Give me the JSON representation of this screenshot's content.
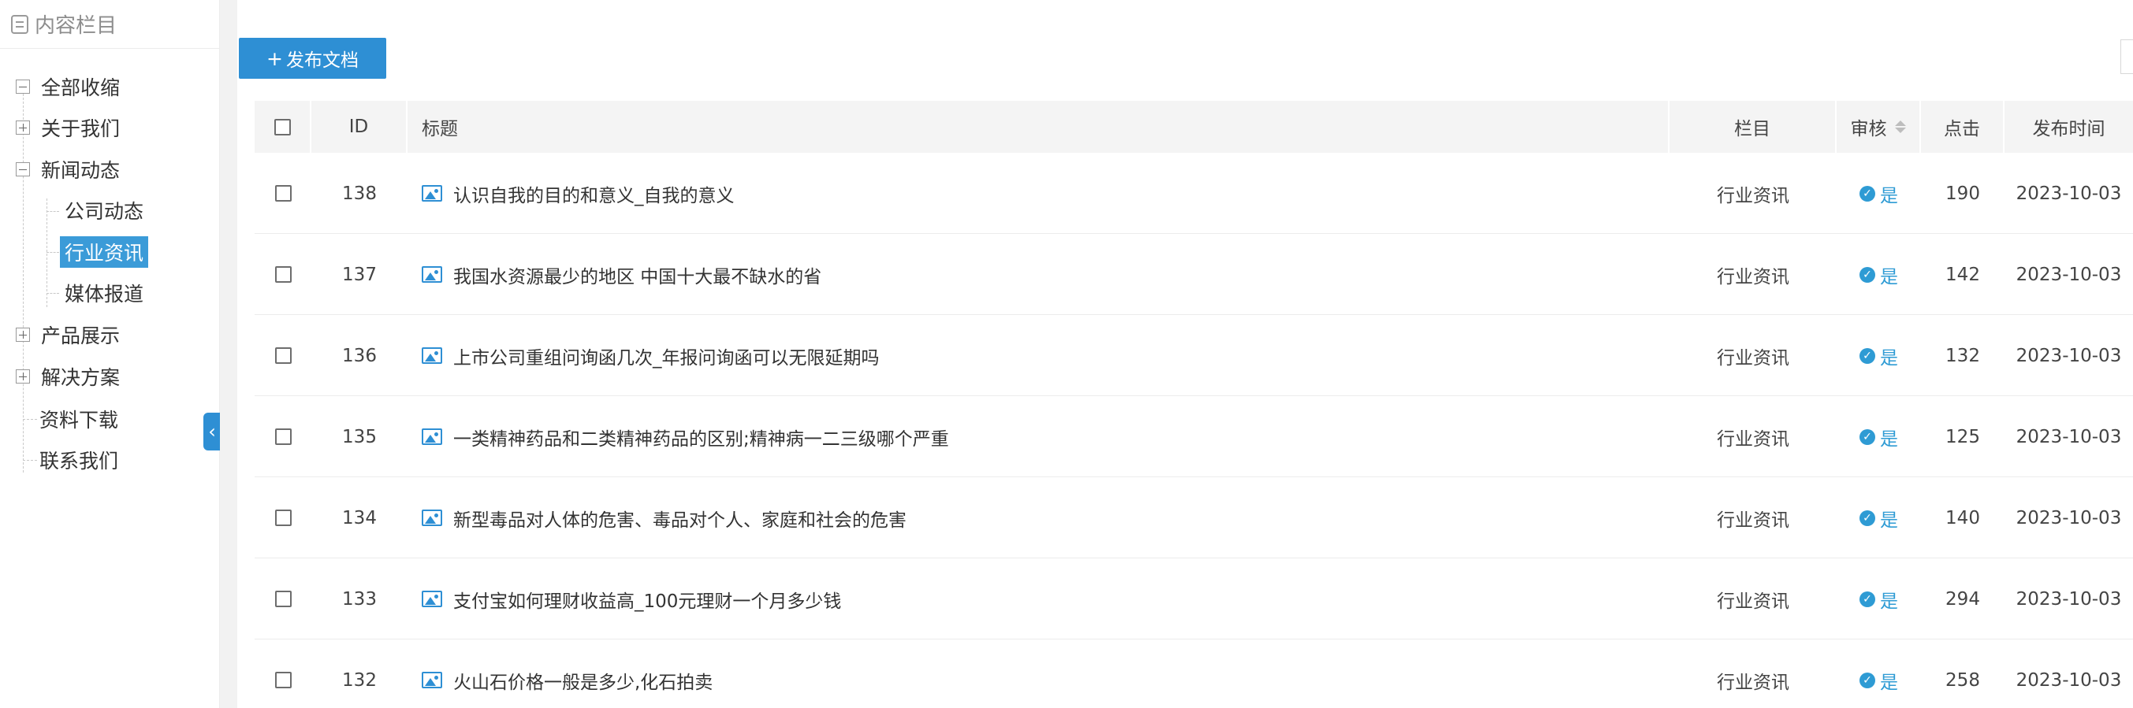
{
  "sidebar": {
    "header": "内容栏目",
    "items": [
      {
        "label": "全部收缩"
      },
      {
        "label": "关于我们"
      },
      {
        "label": "新闻动态"
      },
      {
        "label": "公司动态"
      },
      {
        "label": "行业资讯"
      },
      {
        "label": "媒体报道"
      },
      {
        "label": "产品展示"
      },
      {
        "label": "解决方案"
      },
      {
        "label": "资料下载"
      },
      {
        "label": "联系我们"
      }
    ],
    "selected": "行业资讯"
  },
  "toolbar": {
    "publish_label": "发布文档",
    "publish_plus": "+"
  },
  "table": {
    "headers": {
      "id": "ID",
      "title": "标题",
      "column": "栏目",
      "review": "审核",
      "clicks": "点击",
      "date": "发布时间"
    },
    "rows": [
      {
        "id": "138",
        "title": "认识自我的目的和意义_自我的意义",
        "column": "行业资讯",
        "review": "是",
        "clicks": "190",
        "date": "2023-10-03"
      },
      {
        "id": "137",
        "title": "我国水资源最少的地区 中国十大最不缺水的省",
        "column": "行业资讯",
        "review": "是",
        "clicks": "142",
        "date": "2023-10-03"
      },
      {
        "id": "136",
        "title": "上市公司重组问询函几次_年报问询函可以无限延期吗",
        "column": "行业资讯",
        "review": "是",
        "clicks": "132",
        "date": "2023-10-03"
      },
      {
        "id": "135",
        "title": "一类精神药品和二类精神药品的区别;精神病一二三级哪个严重",
        "column": "行业资讯",
        "review": "是",
        "clicks": "125",
        "date": "2023-10-03"
      },
      {
        "id": "134",
        "title": "新型毒品对人体的危害、毒品对个人、家庭和社会的危害",
        "column": "行业资讯",
        "review": "是",
        "clicks": "140",
        "date": "2023-10-03"
      },
      {
        "id": "133",
        "title": "支付宝如何理财收益高_100元理财一个月多少钱",
        "column": "行业资讯",
        "review": "是",
        "clicks": "294",
        "date": "2023-10-03"
      },
      {
        "id": "132",
        "title": "火山石价格一般是多少,化石拍卖",
        "column": "行业资讯",
        "review": "是",
        "clicks": "258",
        "date": "2023-10-03"
      }
    ]
  },
  "colors": {
    "accent": "#2e8fd4",
    "selected_bg": "#3b9bd8",
    "header_bg": "#f4f4f4"
  },
  "icons": {
    "header": "document-icon",
    "row": "image-icon",
    "review": "check-circle-icon",
    "handle": "chevron-left-icon"
  }
}
